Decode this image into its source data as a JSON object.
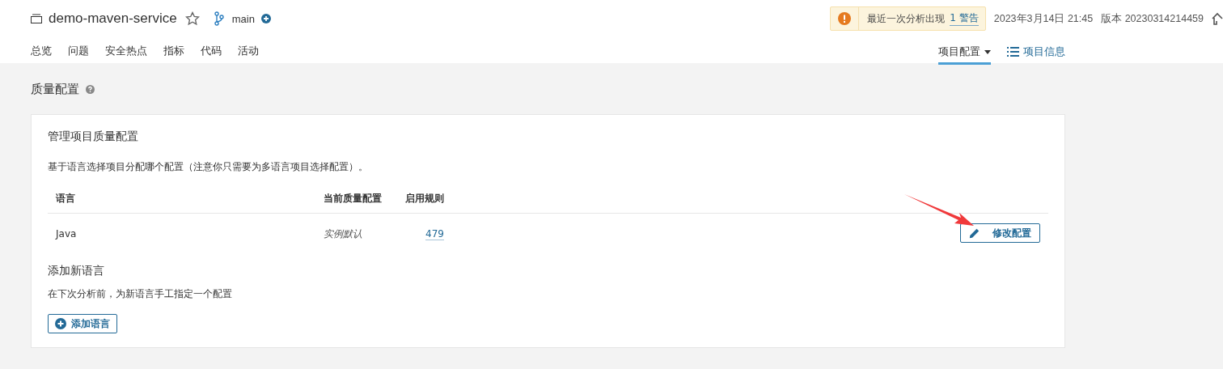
{
  "project": {
    "name": "demo-maven-service",
    "starred": false,
    "branch": "main"
  },
  "warning": {
    "text": "最近一次分析出现",
    "link": "1 警告"
  },
  "analysis": {
    "date": "2023年3月14日 21:45",
    "version": "版本 20230314214459"
  },
  "nav": [
    {
      "label": "总览",
      "selected": false
    },
    {
      "label": "问题",
      "selected": false
    },
    {
      "label": "安全热点",
      "selected": false
    },
    {
      "label": "指标",
      "selected": false
    },
    {
      "label": "代码",
      "selected": false
    },
    {
      "label": "活动",
      "selected": false
    }
  ],
  "right_nav": [
    {
      "label": "项目配置",
      "kind": "dropdown",
      "selected": true
    },
    {
      "label": "项目信息",
      "kind": "list",
      "selected": false
    }
  ],
  "page_title": "质量配置",
  "card": {
    "title": "管理项目质量配置",
    "description": "基于语言选择项目分配哪个配置（注意你只需要为多语言项目选择配置）。",
    "table": {
      "columns": [
        "语言",
        "当前质量配置",
        "启用规则"
      ],
      "rows": [
        {
          "language": "Java",
          "profile": "实例默认",
          "rules": "479",
          "action": "修改配置"
        }
      ]
    },
    "add_title": "添加新语言",
    "add_description": "在下次分析前，为新语言手工指定一个配置",
    "add_button": "添加语言"
  }
}
